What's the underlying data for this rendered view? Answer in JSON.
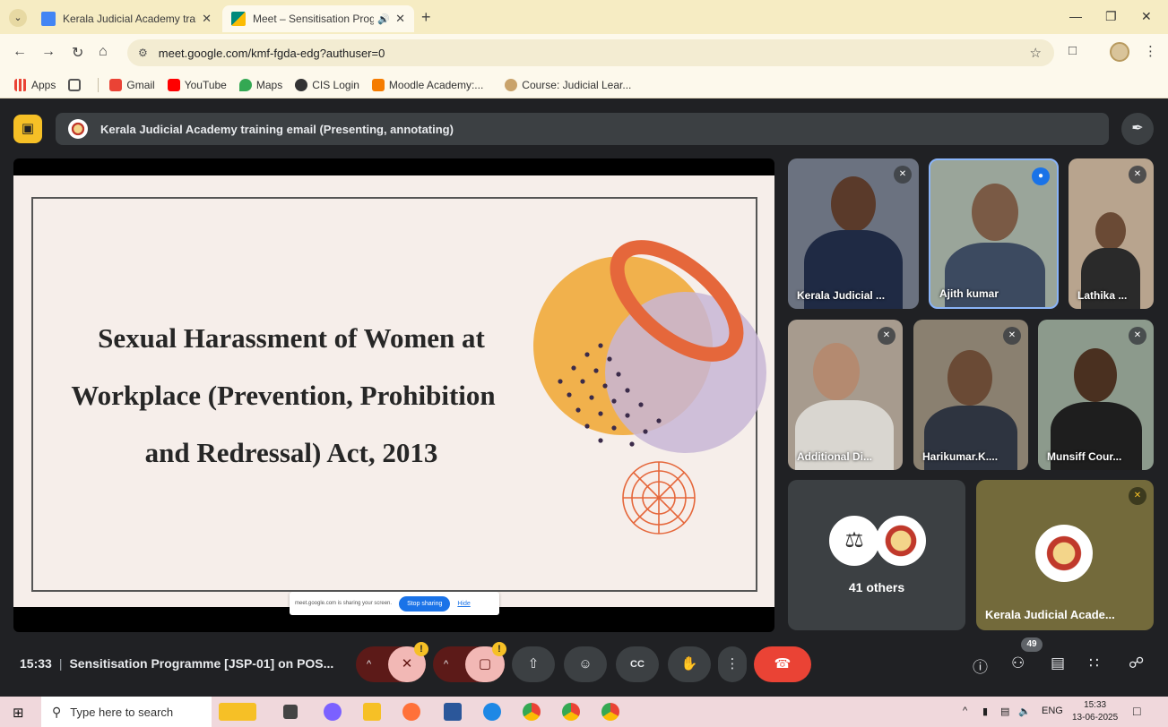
{
  "browser": {
    "tabs": [
      {
        "label": "Kerala Judicial Academy training",
        "favicon_color": "#4285f4"
      },
      {
        "label": "Meet – Sensitisation Progra",
        "favicon_color": "#00897b"
      }
    ],
    "url": "meet.google.com/kmf-fgda-edg?authuser=0",
    "bookmarks": [
      {
        "label": "Apps",
        "color": "#ea4335"
      },
      {
        "label": "Gmail",
        "color": "#ea4335"
      },
      {
        "label": "YouTube",
        "color": "#ff0000"
      },
      {
        "label": "Maps",
        "color": "#34a853"
      },
      {
        "label": "CIS Login",
        "color": "#333333"
      },
      {
        "label": "Moodle Academy:...",
        "color": "#f57c00"
      },
      {
        "label": "Course: Judicial Lear...",
        "color": "#c9a36b"
      }
    ]
  },
  "meet": {
    "presentation_banner": "Kerala Judicial Academy training email (Presenting, annotating)",
    "slide": {
      "title_lines": [
        "Sexual Harassment of Women at",
        "Workplace (Prevention, Prohibition",
        "and Redressal) Act, 2013"
      ],
      "sharing_text": "meet.google.com is sharing your screen.",
      "stop_sharing": "Stop sharing",
      "hide": "Hide"
    },
    "participants": [
      {
        "name": "Kerala Judicial ...",
        "muted": true
      },
      {
        "name": "Ajith kumar",
        "speaking": true
      },
      {
        "name": "Lathika ...",
        "muted": true
      },
      {
        "name": "Additional Di...",
        "muted": true
      },
      {
        "name": "Harikumar.K....",
        "muted": true
      },
      {
        "name": "Munsiff Cour...",
        "muted": true
      }
    ],
    "others_label": "41 others",
    "host_tile_name": "Kerala Judicial Acade...",
    "time": "15:33",
    "meeting_title": "Sensitisation Programme [JSP-01] on POS...",
    "people_count": "49"
  },
  "taskbar": {
    "search_placeholder": "Type here to search",
    "language": "ENG",
    "time": "15:33",
    "date": "13-06-2025"
  }
}
